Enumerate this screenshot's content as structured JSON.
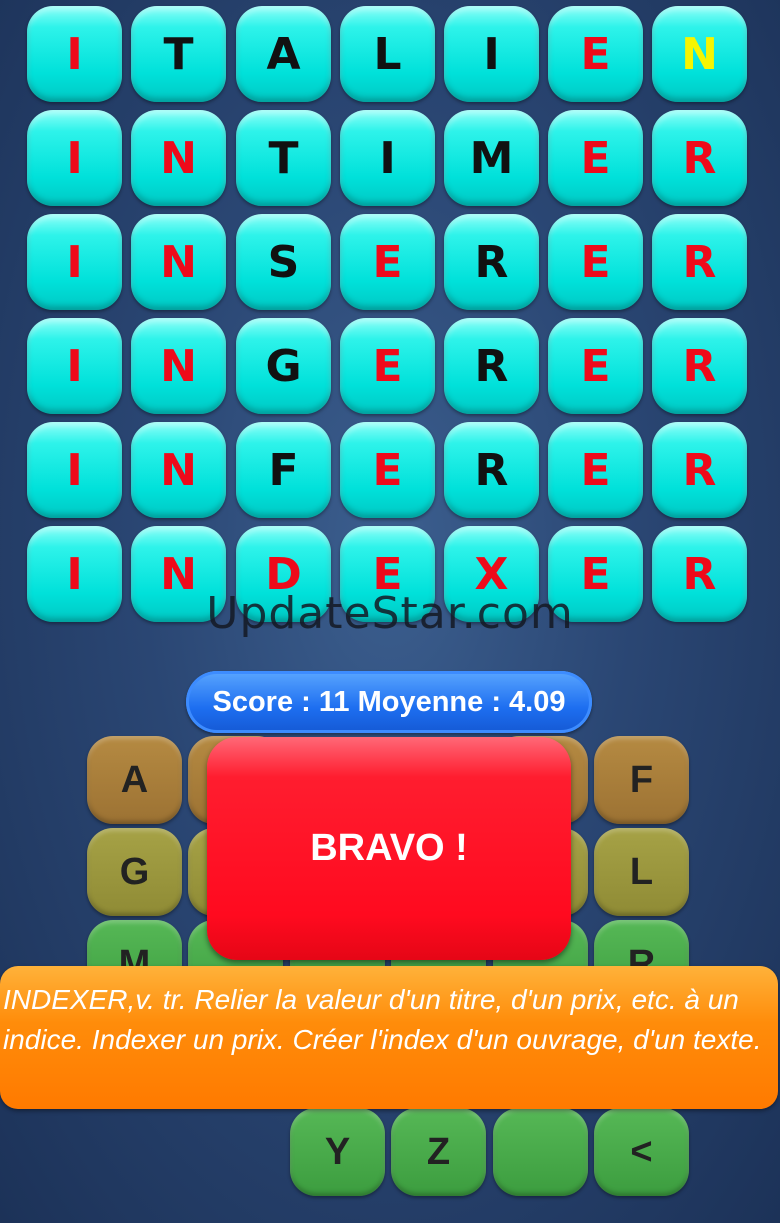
{
  "grid": {
    "rows": [
      [
        {
          "l": "I",
          "c": "red"
        },
        {
          "l": "T",
          "c": "black"
        },
        {
          "l": "A",
          "c": "black"
        },
        {
          "l": "L",
          "c": "black"
        },
        {
          "l": "I",
          "c": "black"
        },
        {
          "l": "E",
          "c": "red"
        },
        {
          "l": "N",
          "c": "yellow"
        }
      ],
      [
        {
          "l": "I",
          "c": "red"
        },
        {
          "l": "N",
          "c": "red"
        },
        {
          "l": "T",
          "c": "black"
        },
        {
          "l": "I",
          "c": "black"
        },
        {
          "l": "M",
          "c": "black"
        },
        {
          "l": "E",
          "c": "red"
        },
        {
          "l": "R",
          "c": "red"
        }
      ],
      [
        {
          "l": "I",
          "c": "red"
        },
        {
          "l": "N",
          "c": "red"
        },
        {
          "l": "S",
          "c": "black"
        },
        {
          "l": "E",
          "c": "red"
        },
        {
          "l": "R",
          "c": "black"
        },
        {
          "l": "E",
          "c": "red"
        },
        {
          "l": "R",
          "c": "red"
        }
      ],
      [
        {
          "l": "I",
          "c": "red"
        },
        {
          "l": "N",
          "c": "red"
        },
        {
          "l": "G",
          "c": "black"
        },
        {
          "l": "E",
          "c": "red"
        },
        {
          "l": "R",
          "c": "black"
        },
        {
          "l": "E",
          "c": "red"
        },
        {
          "l": "R",
          "c": "red"
        }
      ],
      [
        {
          "l": "I",
          "c": "red"
        },
        {
          "l": "N",
          "c": "red"
        },
        {
          "l": "F",
          "c": "black"
        },
        {
          "l": "E",
          "c": "red"
        },
        {
          "l": "R",
          "c": "black"
        },
        {
          "l": "E",
          "c": "red"
        },
        {
          "l": "R",
          "c": "red"
        }
      ],
      [
        {
          "l": "I",
          "c": "red"
        },
        {
          "l": "N",
          "c": "red"
        },
        {
          "l": "D",
          "c": "red"
        },
        {
          "l": "E",
          "c": "red"
        },
        {
          "l": "X",
          "c": "red"
        },
        {
          "l": "E",
          "c": "red"
        },
        {
          "l": "R",
          "c": "red"
        }
      ]
    ]
  },
  "watermark": "UpdateStar.com",
  "score_text": "Score : 11 Moyenne : 4.09",
  "keyboard": {
    "row1": {
      "left": "A",
      "right": "F"
    },
    "row2": {
      "left": "G",
      "right": "L"
    },
    "row3": {
      "left": "M",
      "right": "R"
    },
    "bottom": [
      "Y",
      "Z",
      "",
      "<"
    ]
  },
  "bravo_text": "BRAVO !",
  "definition_text": "INDEXER,v. tr. Relier la valeur d'un titre, d'un prix, etc. à un indice. Indexer un prix. Créer l'index d'un ouvrage, d'un texte.",
  "colors": {
    "cell": "#1ff0e8",
    "red": "#ee0a1a",
    "yellow": "#f5f500",
    "score": "#1d6ef0",
    "bravo": "#ff0a1f",
    "definition": "#ff8c0a"
  }
}
